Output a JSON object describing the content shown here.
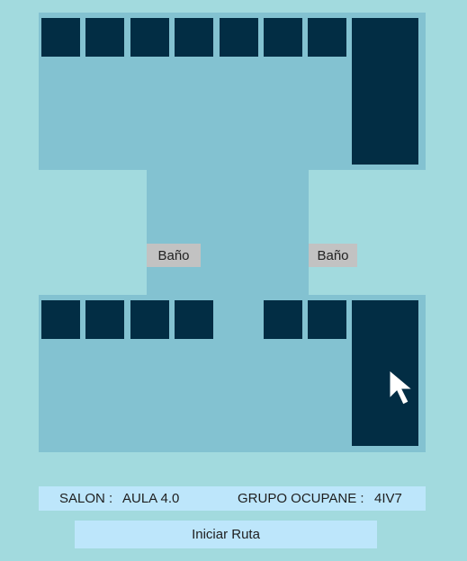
{
  "map": {
    "bathroom_left_label": "Baño",
    "bathroom_right_label": "Baño",
    "cursor_icon": "mouse-pointer-arrow-icon",
    "colors": {
      "background": "#a2dade",
      "floor": "#83c2d1",
      "room": "#022d44",
      "bathroom": "#c2c2c2",
      "panel": "#bde6fb"
    }
  },
  "info": {
    "salon_label": "SALON :",
    "salon_value": "AULA 4.0",
    "grupo_label": "GRUPO OCUPANE :",
    "grupo_value": "4IV7"
  },
  "actions": {
    "start_route_label": "Iniciar Ruta"
  }
}
